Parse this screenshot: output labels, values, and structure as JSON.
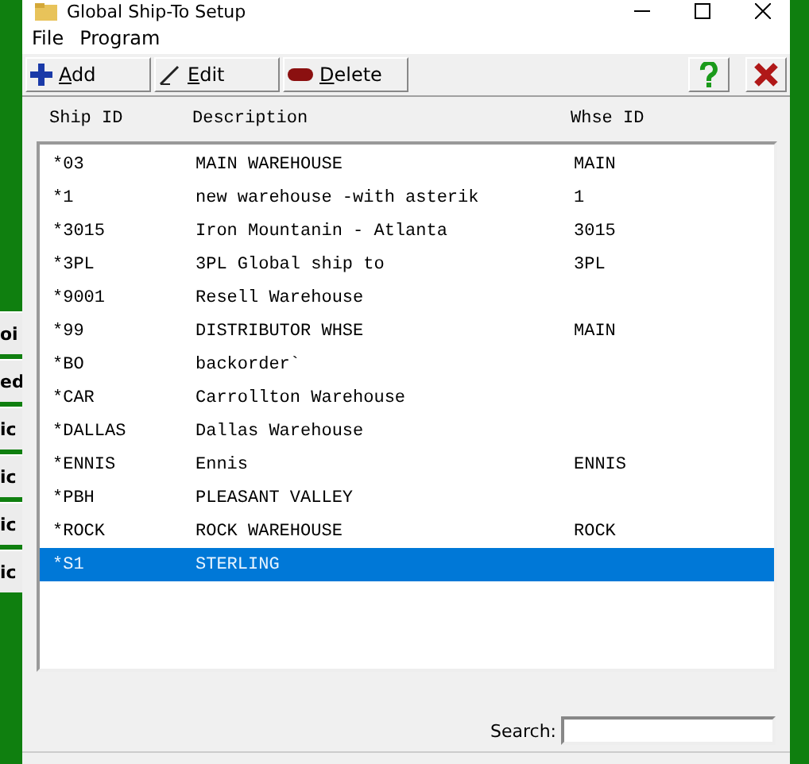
{
  "background_buttons": [
    "oi",
    "ed",
    "ic",
    "ic",
    "ic",
    "ic"
  ],
  "window": {
    "title": "Global Ship-To Setup"
  },
  "menu": [
    "File",
    "Program"
  ],
  "toolbar": [
    {
      "label": "Add",
      "kind": "add"
    },
    {
      "label": "Edit",
      "kind": "edit"
    },
    {
      "label": "Delete",
      "kind": "delete"
    }
  ],
  "table": {
    "columns": [
      "Ship ID",
      "Description",
      "Whse ID"
    ],
    "rows": [
      {
        "ship_id": "*03",
        "description": "MAIN WAREHOUSE",
        "whse_id": "MAIN",
        "selected": false
      },
      {
        "ship_id": "*1",
        "description": "new warehouse -with asterik",
        "whse_id": "1",
        "selected": false
      },
      {
        "ship_id": "*3015",
        "description": "Iron Mountanin - Atlanta",
        "whse_id": "3015",
        "selected": false
      },
      {
        "ship_id": "*3PL",
        "description": "3PL Global ship to",
        "whse_id": "3PL",
        "selected": false
      },
      {
        "ship_id": "*9001",
        "description": "Resell Warehouse",
        "selected": false
      },
      {
        "ship_id": "*99",
        "description": "DISTRIBUTOR WHSE",
        "whse_id": "MAIN",
        "selected": false
      },
      {
        "ship_id": "*BO",
        "description": "backorder`",
        "selected": false
      },
      {
        "ship_id": "*CAR",
        "description": "Carrollton Warehouse",
        "selected": false
      },
      {
        "ship_id": "*DALLAS",
        "description": "Dallas Warehouse",
        "selected": false
      },
      {
        "ship_id": "*ENNIS",
        "description": "Ennis",
        "whse_id": "ENNIS",
        "selected": false
      },
      {
        "ship_id": "*PBH",
        "description": "PLEASANT VALLEY",
        "selected": false
      },
      {
        "ship_id": "*ROCK",
        "description": "ROCK WAREHOUSE",
        "whse_id": "ROCK",
        "selected": false
      },
      {
        "ship_id": "*S1",
        "description": "STERLING",
        "selected": true
      }
    ]
  },
  "search": {
    "label": "Search:"
  }
}
